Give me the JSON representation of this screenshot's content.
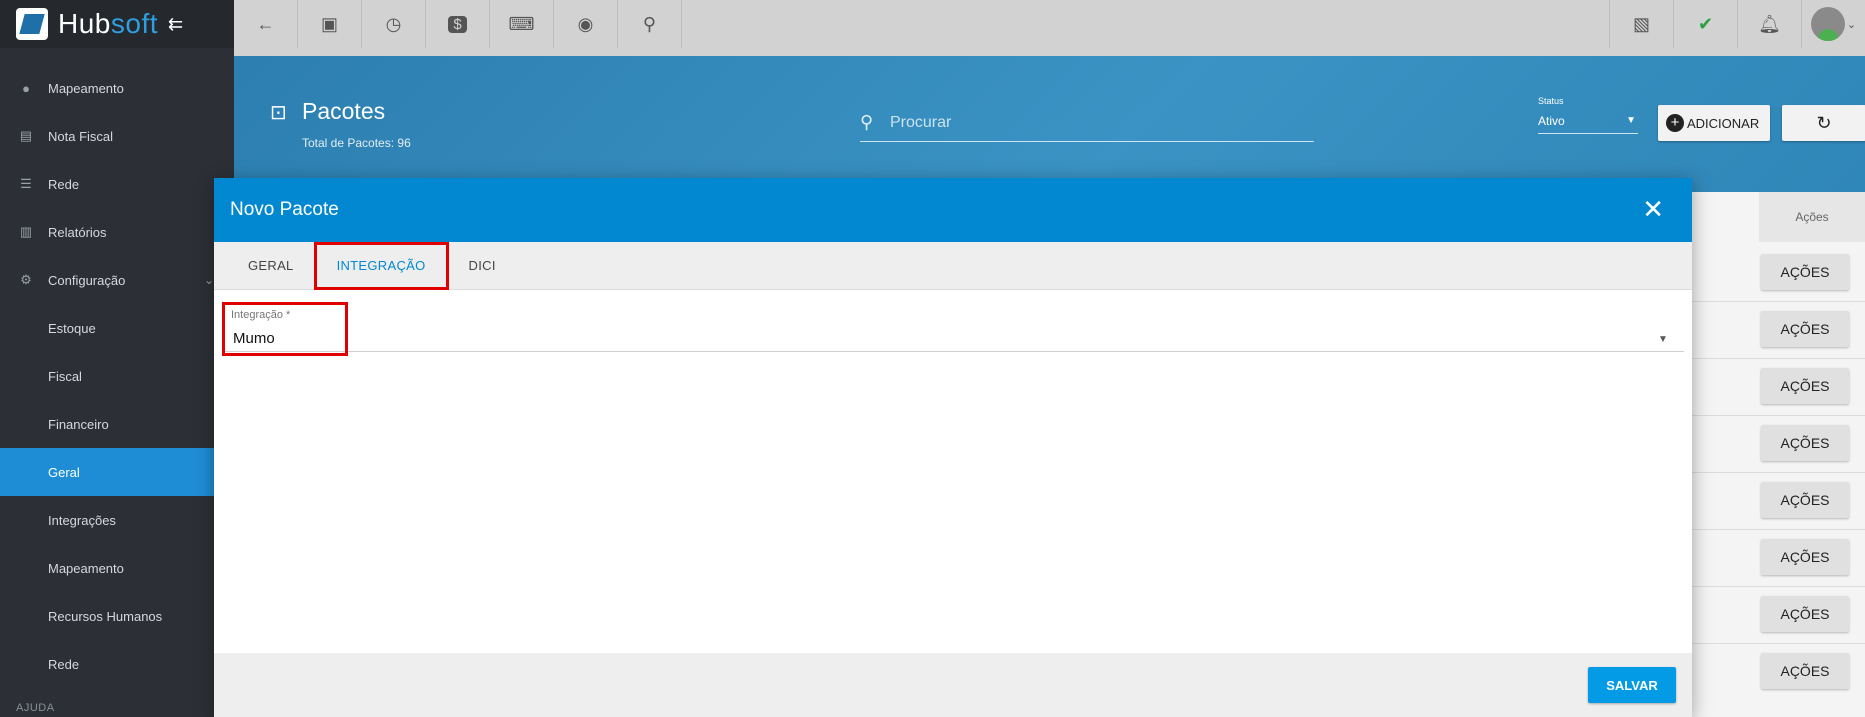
{
  "brand": {
    "name_main": "Hub",
    "name_accent": "soft"
  },
  "sidebar": {
    "items": [
      {
        "label": "Mapeamento",
        "icon": "map-pin-icon"
      },
      {
        "label": "Nota Fiscal",
        "icon": "document-icon"
      },
      {
        "label": "Rede",
        "icon": "server-icon"
      },
      {
        "label": "Relatórios",
        "icon": "report-icon"
      },
      {
        "label": "Configuração",
        "icon": "gear-icon"
      }
    ],
    "subitems": [
      "Estoque",
      "Fiscal",
      "Financeiro",
      "Geral",
      "Integrações",
      "Mapeamento",
      "Recursos Humanos",
      "Rede"
    ],
    "section": "AJUDA"
  },
  "header": {
    "title": "Pacotes",
    "subtitle": "Total de Pacotes: 96",
    "search_placeholder": "Procurar",
    "status_label": "Status",
    "status_value": "Ativo",
    "add_label": "ADICIONAR"
  },
  "table": {
    "actions_header": "Ações",
    "actions_label": "AÇÕES"
  },
  "modal": {
    "title": "Novo Pacote",
    "tabs": [
      "GERAL",
      "INTEGRAÇÃO",
      "DICI"
    ],
    "field_label": "Integração *",
    "field_value": "Mumo",
    "save_label": "SALVAR"
  }
}
